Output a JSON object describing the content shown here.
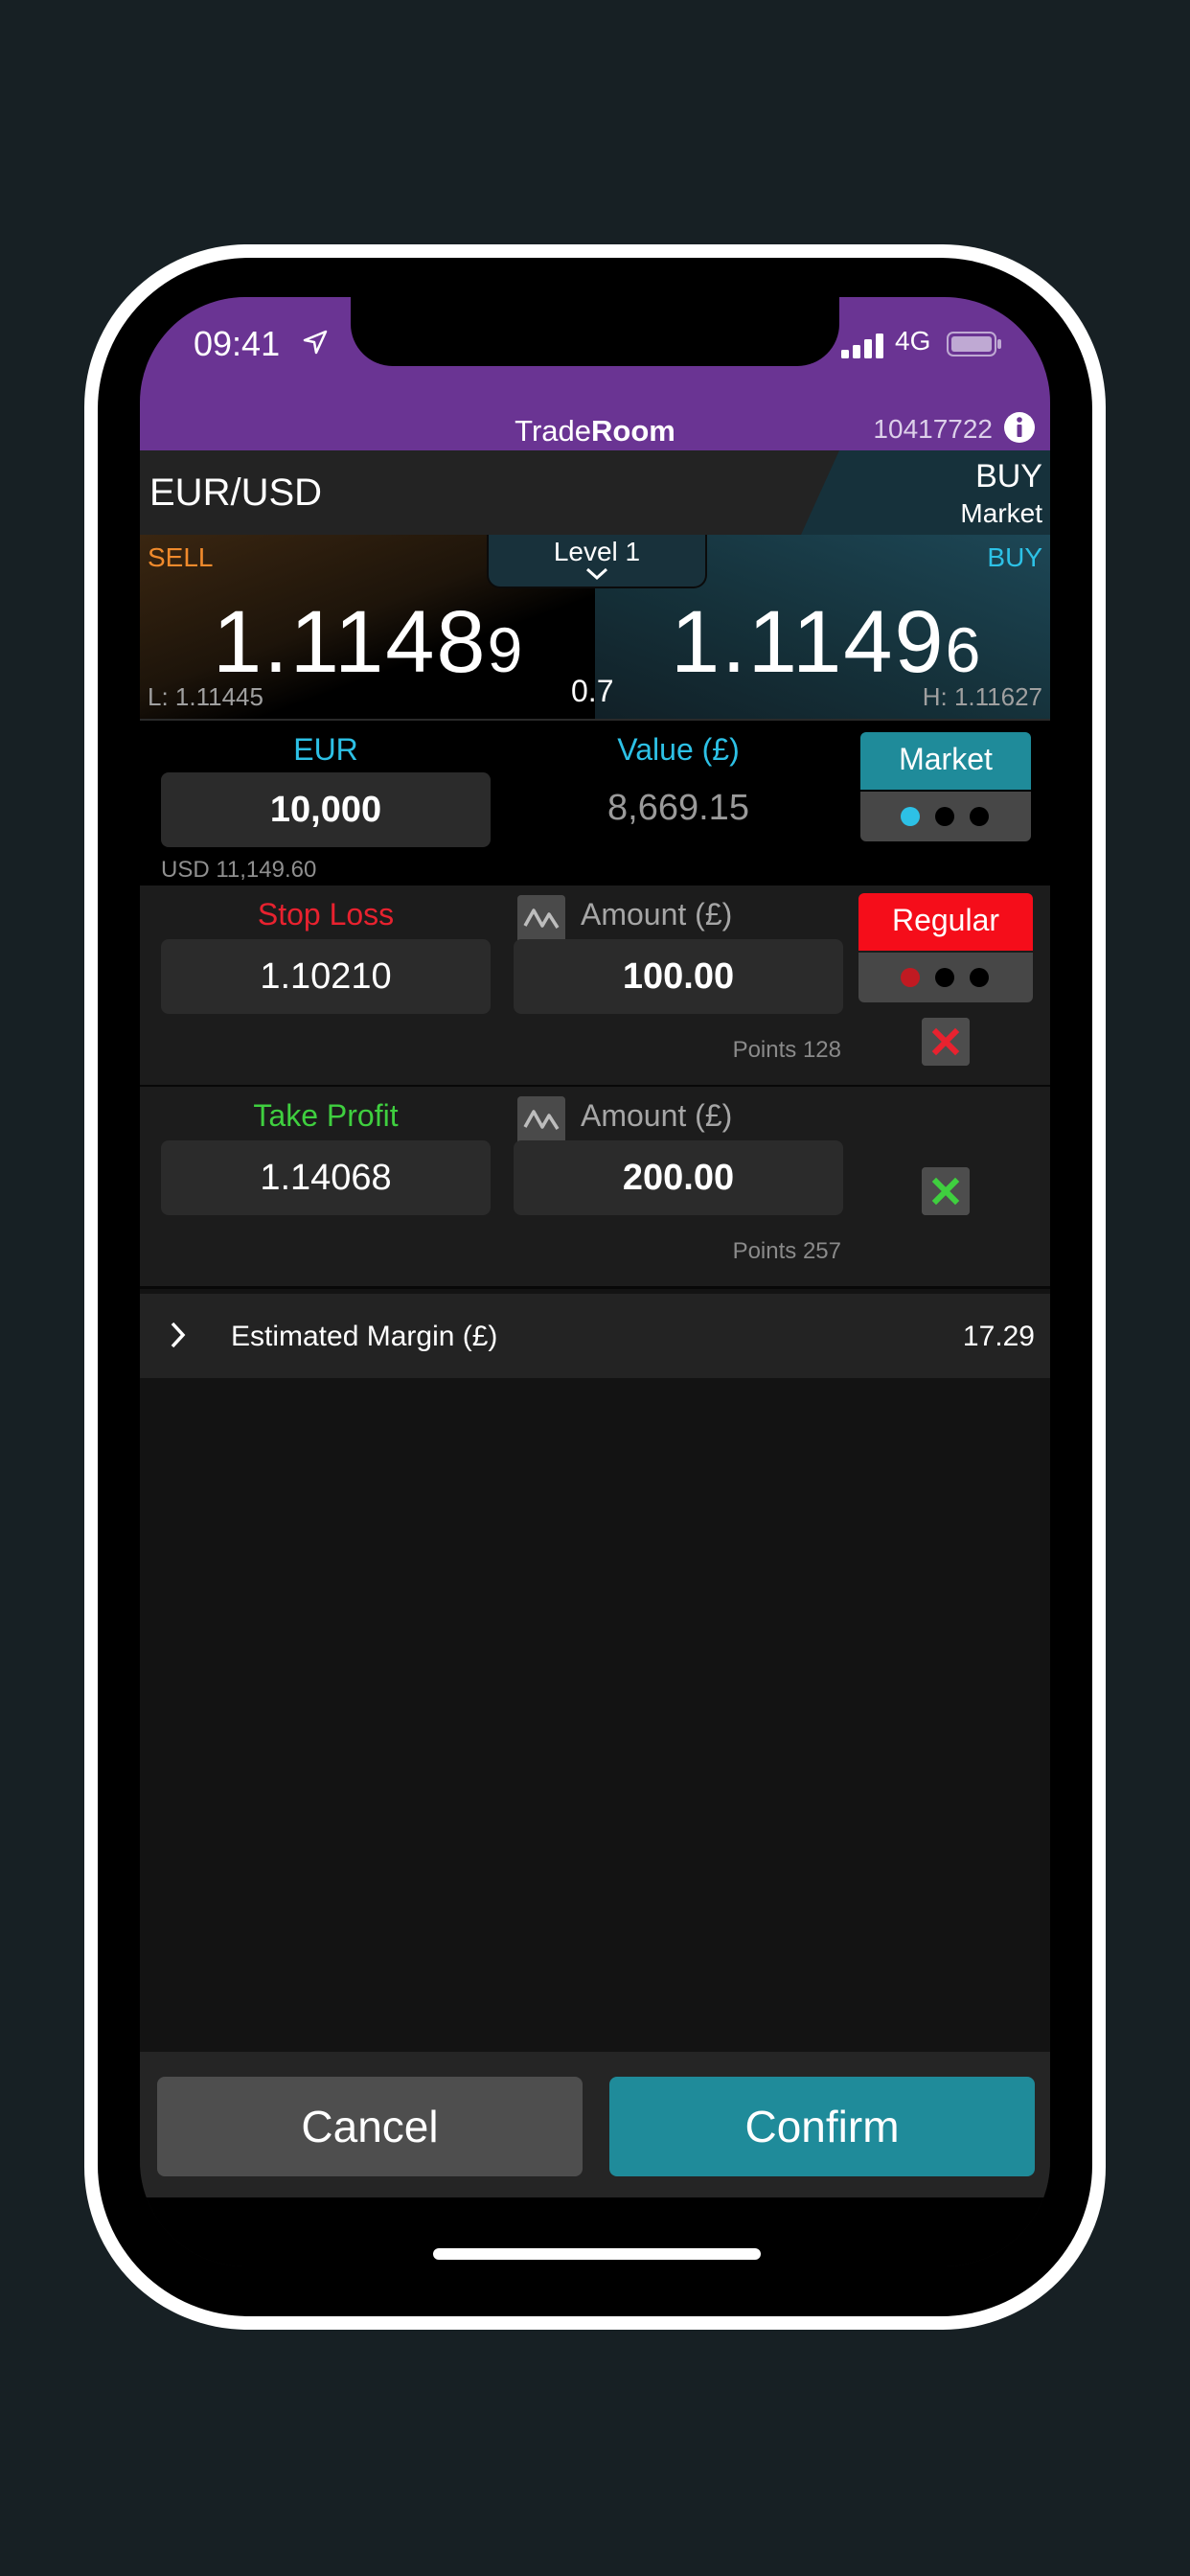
{
  "status_bar": {
    "time": "09:41",
    "network": "4G"
  },
  "header": {
    "brand_light": "Trade",
    "brand_bold": "Room",
    "account_number": "10417722"
  },
  "instrument": {
    "pair": "EUR/USD",
    "direction": "BUY",
    "order_type": "Market"
  },
  "quote": {
    "sell_label": "SELL",
    "buy_label": "BUY",
    "sell_price_main": "1.1148",
    "sell_price_pip": "9",
    "buy_price_main": "1.1149",
    "buy_price_pip": "6",
    "low": "L: 1.11445",
    "high": "H: 1.11627",
    "spread": "0.7",
    "level_label": "Level 1"
  },
  "size": {
    "currency_label": "EUR",
    "quantity": "10,000",
    "usd_equivalent": "USD 11,149.60",
    "value_label": "Value (£)",
    "value": "8,669.15",
    "type_button": "Market"
  },
  "stop_loss": {
    "label": "Stop Loss",
    "price": "1.10210",
    "amount_label": "Amount (£)",
    "amount": "100.00",
    "points": "Points 128",
    "type_button": "Regular"
  },
  "take_profit": {
    "label": "Take Profit",
    "price": "1.14068",
    "amount_label": "Amount (£)",
    "amount": "200.00",
    "points": "Points 257"
  },
  "margin": {
    "label": "Estimated Margin (£)",
    "value": "17.29"
  },
  "actions": {
    "cancel": "Cancel",
    "confirm": "Confirm"
  },
  "colors": {
    "status_bar": "#6a3493",
    "sell": "#f08a2c",
    "buy": "#2dc1e6",
    "stop_loss": "#e8222f",
    "take_profit": "#3fcf3f",
    "confirm": "#1f8b9a"
  }
}
